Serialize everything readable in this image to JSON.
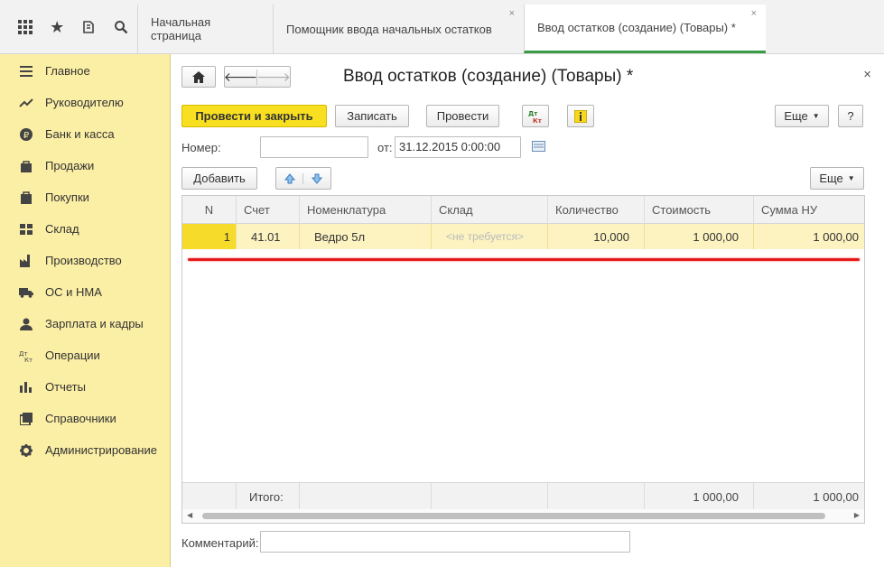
{
  "top_icons": [
    "apps-grid-icon",
    "star-icon",
    "history-icon",
    "search-icon"
  ],
  "tabs": [
    {
      "label": "Начальная страница"
    },
    {
      "label": "Помощник ввода начальных остатков"
    },
    {
      "label": "Ввод остатков (создание) (Товары) *"
    }
  ],
  "tab_close": "×",
  "sidebar": {
    "items": [
      {
        "label": "Главное",
        "icon": "menu-icon"
      },
      {
        "label": "Руководителю",
        "icon": "trend-icon"
      },
      {
        "label": "Банк и касса",
        "icon": "ruble-icon"
      },
      {
        "label": "Продажи",
        "icon": "bag-icon"
      },
      {
        "label": "Покупки",
        "icon": "cart-icon"
      },
      {
        "label": "Склад",
        "icon": "warehouse-icon"
      },
      {
        "label": "Производство",
        "icon": "factory-icon"
      },
      {
        "label": "ОС и НМА",
        "icon": "truck-icon"
      },
      {
        "label": "Зарплата и кадры",
        "icon": "person-icon"
      },
      {
        "label": "Операции",
        "icon": "dt-kt-icon"
      },
      {
        "label": "Отчеты",
        "icon": "bar-chart-icon"
      },
      {
        "label": "Справочники",
        "icon": "book-icon"
      },
      {
        "label": "Администрирование",
        "icon": "gear-icon"
      }
    ]
  },
  "form": {
    "title": "Ввод остатков (создание) (Товары) *",
    "close": "×",
    "toolbar": {
      "post_close": "Провести и закрыть",
      "save": "Записать",
      "post": "Провести",
      "more": "Еще",
      "help": "?"
    },
    "number_label": "Номер:",
    "number_value": "",
    "date_label": "от:",
    "date_value": "31.12.2015  0:00:00",
    "add_button": "Добавить",
    "table_more": "Еще",
    "comment_label": "Комментарий:",
    "comment_value": ""
  },
  "table": {
    "columns": [
      "N",
      "Счет",
      "Номенклатура",
      "Склад",
      "Количество",
      "Стоимость",
      "Сумма НУ"
    ],
    "rows": [
      {
        "n": "1",
        "account": "41.01",
        "item": "Ведро 5л",
        "warehouse": "<не требуется>",
        "qty": "10,000",
        "cost": "1 000,00",
        "tax_sum": "1 000,00"
      }
    ],
    "footer": {
      "label": "Итого:",
      "cost": "1 000,00",
      "tax_sum": "1 000,00"
    }
  },
  "colors": {
    "sidebar_bg": "#fbeea5",
    "primary_button": "#f8e020",
    "selected_row": "#fcf3c1",
    "active_tab_underline": "#3a9b46",
    "annotation_line": "#e51a1a"
  }
}
